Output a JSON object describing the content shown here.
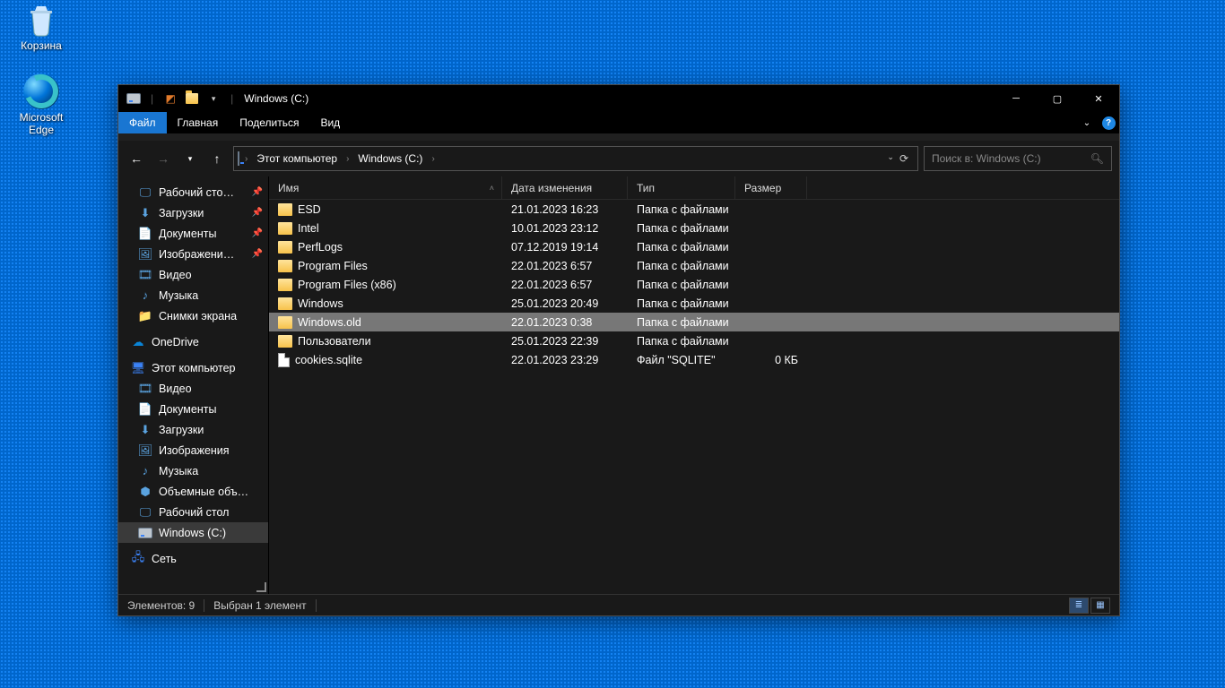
{
  "desktop": {
    "recycle": "Корзина",
    "edge": "Microsoft Edge"
  },
  "window": {
    "title": "Windows (C:)",
    "tabs": {
      "file": "Файл",
      "home": "Главная",
      "share": "Поделиться",
      "view": "Вид"
    },
    "breadcrumb": {
      "root": "Этот компьютер",
      "here": "Windows (C:)"
    },
    "search_placeholder": "Поиск в: Windows (C:)",
    "columns": {
      "name": "Имя",
      "date": "Дата изменения",
      "type": "Тип",
      "size": "Размер"
    },
    "sidebar": {
      "quick": [
        {
          "label": "Рабочий сто…",
          "icon": "desktop",
          "pin": true
        },
        {
          "label": "Загрузки",
          "icon": "download",
          "pin": true
        },
        {
          "label": "Документы",
          "icon": "doc",
          "pin": true
        },
        {
          "label": "Изображени…",
          "icon": "pic",
          "pin": true
        },
        {
          "label": "Видео",
          "icon": "video",
          "pin": false
        },
        {
          "label": "Музыка",
          "icon": "music",
          "pin": false
        },
        {
          "label": "Снимки экрана",
          "icon": "folder",
          "pin": false
        }
      ],
      "onedrive": "OneDrive",
      "thispc_label": "Этот компьютер",
      "thispc": [
        {
          "label": "Видео",
          "icon": "video"
        },
        {
          "label": "Документы",
          "icon": "doc"
        },
        {
          "label": "Загрузки",
          "icon": "download"
        },
        {
          "label": "Изображения",
          "icon": "pic"
        },
        {
          "label": "Музыка",
          "icon": "music"
        },
        {
          "label": "Объемные объ…",
          "icon": "3d"
        },
        {
          "label": "Рабочий стол",
          "icon": "desktop"
        },
        {
          "label": "Windows (C:)",
          "icon": "drive",
          "selected": true
        }
      ],
      "network": "Сеть"
    },
    "files": [
      {
        "name": "ESD",
        "date": "21.01.2023 16:23",
        "type": "Папка с файлами",
        "size": "",
        "kind": "folder"
      },
      {
        "name": "Intel",
        "date": "10.01.2023 23:12",
        "type": "Папка с файлами",
        "size": "",
        "kind": "folder"
      },
      {
        "name": "PerfLogs",
        "date": "07.12.2019 19:14",
        "type": "Папка с файлами",
        "size": "",
        "kind": "folder"
      },
      {
        "name": "Program Files",
        "date": "22.01.2023 6:57",
        "type": "Папка с файлами",
        "size": "",
        "kind": "folder"
      },
      {
        "name": "Program Files (x86)",
        "date": "22.01.2023 6:57",
        "type": "Папка с файлами",
        "size": "",
        "kind": "folder"
      },
      {
        "name": "Windows",
        "date": "25.01.2023 20:49",
        "type": "Папка с файлами",
        "size": "",
        "kind": "folder"
      },
      {
        "name": "Windows.old",
        "date": "22.01.2023 0:38",
        "type": "Папка с файлами",
        "size": "",
        "kind": "folder",
        "selected": true
      },
      {
        "name": "Пользователи",
        "date": "25.01.2023 22:39",
        "type": "Папка с файлами",
        "size": "",
        "kind": "folder"
      },
      {
        "name": "cookies.sqlite",
        "date": "22.01.2023 23:29",
        "type": "Файл \"SQLITE\"",
        "size": "0 КБ",
        "kind": "file"
      }
    ],
    "status": {
      "count": "Элементов: 9",
      "selection": "Выбран 1 элемент"
    }
  }
}
